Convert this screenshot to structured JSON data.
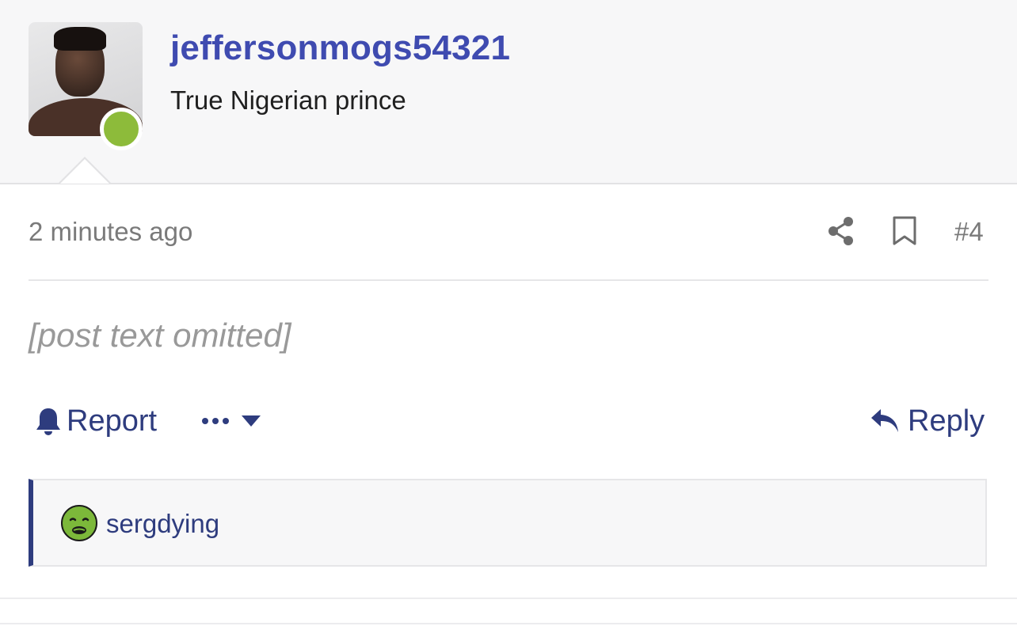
{
  "user": {
    "username": "jeffersonmogs54321",
    "title": "True Nigerian prince",
    "online": true
  },
  "post": {
    "timestamp": "2 minutes ago",
    "number": "#4",
    "body": "[post text omitted]"
  },
  "actions": {
    "report_label": "Report",
    "reply_label": "Reply"
  },
  "reactions": {
    "user": "sergdying",
    "emoji": "nauseated-face-icon"
  },
  "colors": {
    "accent": "#2e3c7e",
    "username": "#3f4bb0",
    "online": "#8dbb3a",
    "header_bg": "#f7f7f8"
  },
  "icons": [
    "share-icon",
    "bookmark-icon",
    "bell-icon",
    "dots-icon",
    "chevron-down-icon",
    "reply-icon",
    "nauseated-face-icon"
  ]
}
